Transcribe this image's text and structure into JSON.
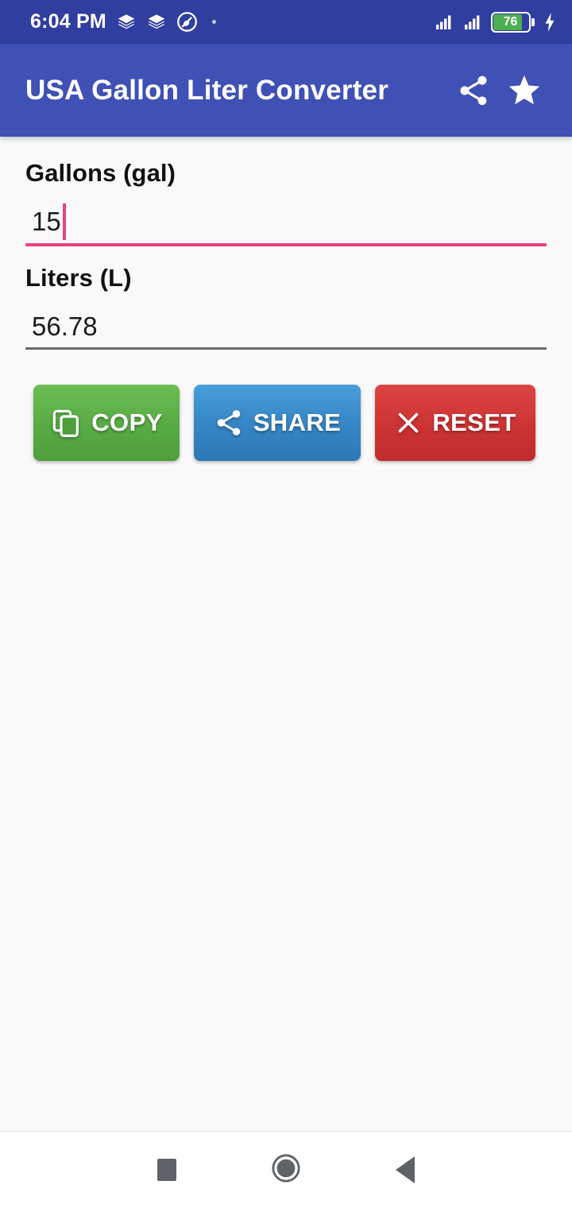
{
  "status_bar": {
    "time": "6:04 PM",
    "left_icons": [
      "layers-icon",
      "layers-icon",
      "adblock-circle-icon",
      "dot-indicator-icon"
    ],
    "signal_icons": [
      "signal-bars-icon",
      "signal-bars-icon"
    ],
    "battery_level": "76",
    "battery_charging_icon": "lightning-bolt-icon",
    "background_color": "#303F9F"
  },
  "app_bar": {
    "title": "USA Gallon Liter Converter",
    "share_icon": "share-icon",
    "favorite_icon": "star-icon",
    "background_color": "#3F51B5"
  },
  "form": {
    "gallons": {
      "label": "Gallons (gal)",
      "value": "15",
      "placeholder": "",
      "underline_color": "#E8437F",
      "focused": true
    },
    "liters": {
      "label": "Liters (L)",
      "value": "56.78",
      "placeholder": "",
      "underline_color": "#6B6B6B",
      "focused": false
    }
  },
  "actions": {
    "copy": {
      "label": "COPY",
      "icon": "copy-icon",
      "color": "#58AB44"
    },
    "share": {
      "label": "SHARE",
      "icon": "share-icon",
      "color": "#3585C4"
    },
    "reset": {
      "label": "RESET",
      "icon": "close-x-icon",
      "color": "#CC3333"
    }
  },
  "nav_bar": {
    "recents_icon": "square-recents-icon",
    "home_icon": "circle-home-icon",
    "back_icon": "triangle-back-icon"
  }
}
